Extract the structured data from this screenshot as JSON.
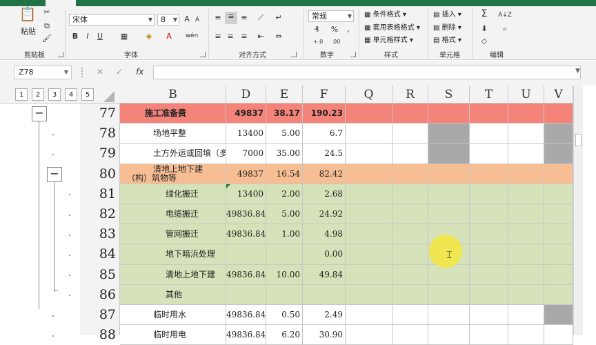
{
  "ribbon": {
    "clipboard": {
      "paste": "粘贴",
      "label": "剪贴板"
    },
    "font": {
      "name": "宋体",
      "size": "8",
      "bold": "B",
      "italic": "I",
      "underline": "U",
      "label": "字体"
    },
    "alignment": {
      "label": "对齐方式"
    },
    "number": {
      "format": "常规",
      "label": "数字"
    },
    "styles": {
      "conditional": "条件格式",
      "table": "套用表格格式",
      "cell": "单元格样式",
      "label": "样式"
    },
    "cells": {
      "insert": "插入",
      "delete": "删除",
      "format": "格式",
      "label": "单元格"
    },
    "editing": {
      "label": "编辑"
    }
  },
  "formula_bar": {
    "name_box": "Z78",
    "cancel": "✕",
    "enter": "✓",
    "fx": "fx",
    "content": ""
  },
  "outline_levels": [
    "1",
    "2",
    "3",
    "4",
    "5"
  ],
  "columns": [
    "B",
    "D",
    "E",
    "F",
    "Q",
    "R",
    "S",
    "T",
    "U",
    "V"
  ],
  "rows": [
    {
      "num": "77",
      "fill": "#f4837a",
      "bold": true,
      "b": "施工准备费",
      "b_indent": "0",
      "d": "49837",
      "e": "38.17",
      "f": "190.23",
      "grey": []
    },
    {
      "num": "78",
      "fill": "#ffffff",
      "bold": false,
      "b": "场地平整",
      "b_indent": "1",
      "d": "13400",
      "e": "5.00",
      "f": "6.7",
      "grey": [
        "S",
        "V"
      ]
    },
    {
      "num": "79",
      "fill": "#ffffff",
      "bold": false,
      "b": "土方外运或回填（多",
      "b_indent": "1",
      "d": "7000",
      "e": "35.00",
      "f": "24.5",
      "grey": [
        "S",
        "V"
      ]
    },
    {
      "num": "80",
      "fill": "#f8be93",
      "bold": false,
      "b": "清地上地下建",
      "b2": "（构）筑物等",
      "b_indent": "1",
      "d": "49837",
      "e": "16.54",
      "f": "82.42",
      "grey": []
    },
    {
      "num": "81",
      "fill": "#d6e2b9",
      "bold": false,
      "b": "绿化搬迁",
      "b_indent": "2",
      "d": "13400",
      "e": "2.00",
      "f": "2.68",
      "grey": []
    },
    {
      "num": "82",
      "fill": "#d6e2b9",
      "bold": false,
      "b": "电缆搬迁",
      "b_indent": "2",
      "d": "49836.84",
      "e": "5.00",
      "f": "24.92",
      "grey": []
    },
    {
      "num": "83",
      "fill": "#d6e2b9",
      "bold": false,
      "b": "管网搬迁",
      "b_indent": "2",
      "d": "49836.84",
      "e": "1.00",
      "f": "4.98",
      "grey": []
    },
    {
      "num": "84",
      "fill": "#d6e2b9",
      "bold": false,
      "b": "地下暗浜处理",
      "b_indent": "2",
      "d": "",
      "e": "",
      "f": "0.00",
      "grey": []
    },
    {
      "num": "85",
      "fill": "#d6e2b9",
      "bold": false,
      "b": "清地上地下建",
      "b_indent": "2",
      "d": "49836.84",
      "e": "10.00",
      "f": "49.84",
      "grey": []
    },
    {
      "num": "86",
      "fill": "#d6e2b9",
      "bold": false,
      "b": "其他",
      "b_indent": "2",
      "d": "",
      "e": "",
      "f": "",
      "grey": []
    },
    {
      "num": "87",
      "fill": "#ffffff",
      "bold": false,
      "b": "临时用水",
      "b_indent": "1",
      "d": "49836.84",
      "e": "0.50",
      "f": "2.49",
      "grey": [
        "V"
      ]
    },
    {
      "num": "88",
      "fill": "#ffffff",
      "bold": false,
      "b": "临时用电",
      "b_indent": "1",
      "d": "49836.84",
      "e": "6.20",
      "f": "30.90",
      "grey": []
    }
  ],
  "colors": {
    "ribbon_green": "#217346",
    "grey_cell": "#a9a9a9"
  }
}
